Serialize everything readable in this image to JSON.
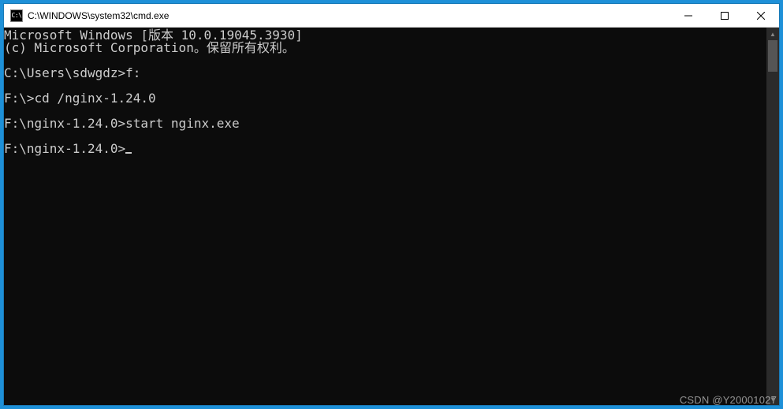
{
  "titlebar": {
    "icon_label": "C:\\",
    "title": "C:\\WINDOWS\\system32\\cmd.exe"
  },
  "console": {
    "lines": [
      "Microsoft Windows [版本 10.0.19045.3930]",
      "(c) Microsoft Corporation。保留所有权利。",
      "",
      "C:\\Users\\sdwgdz>f:",
      "",
      "F:\\>cd /nginx-1.24.0",
      "",
      "F:\\nginx-1.24.0>start nginx.exe",
      "",
      "F:\\nginx-1.24.0>"
    ],
    "cursor_on_last": true
  },
  "watermark": "CSDN @Y20001027"
}
